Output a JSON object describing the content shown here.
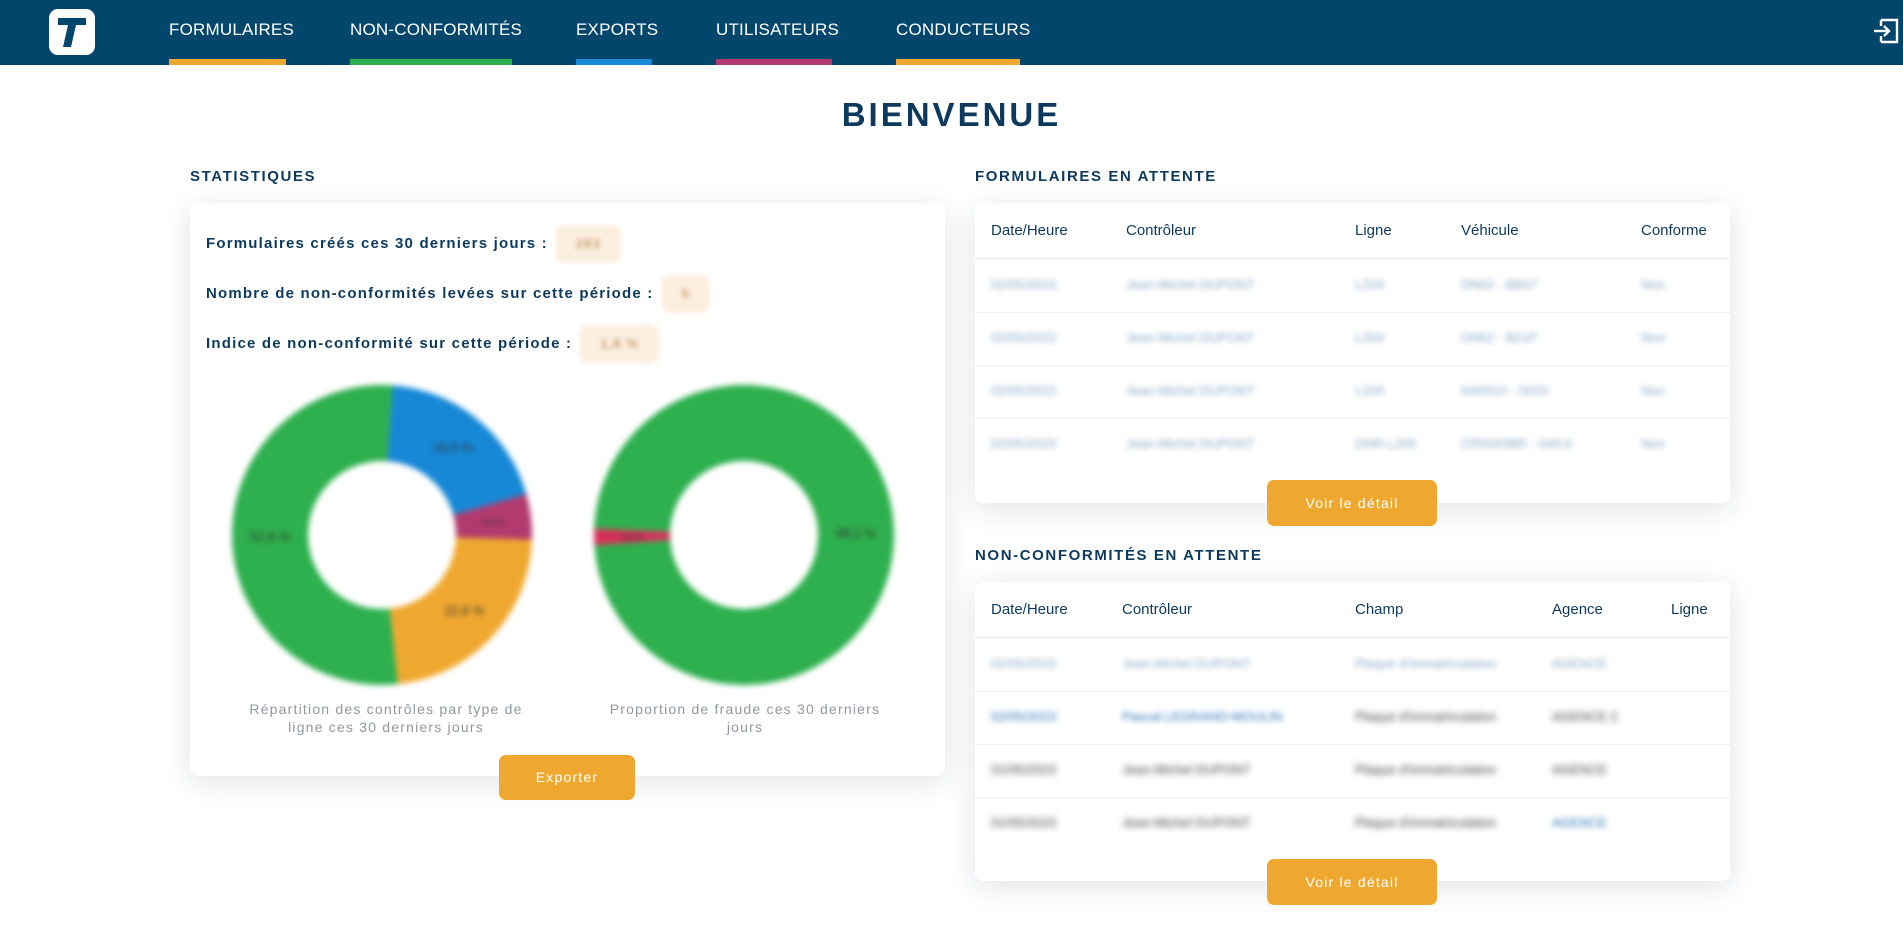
{
  "nav": {
    "items": [
      {
        "label": "FORMULAIRES",
        "color": "#efa82f"
      },
      {
        "label": "NON-CONFORMITÉS",
        "color": "#2eb04e"
      },
      {
        "label": "EXPORTS",
        "color": "#1688d6"
      },
      {
        "label": "UTILISATEURS",
        "color": "#b23a6e"
      },
      {
        "label": "CONDUCTEURS",
        "color": "#efa82f"
      }
    ],
    "logo_icon": "t-logo-icon",
    "logout_icon": "logout-icon"
  },
  "page_title": "BIENVENUE",
  "stats": {
    "section_title": "STATISTIQUES",
    "forms_label": "Formulaires créés ces 30 derniers jours :",
    "forms_value": "283",
    "nc_label": "Nombre de non-conformités levées sur cette période :",
    "nc_value": "5",
    "index_label": "Indice de non-conformité sur cette période :",
    "index_value": "1,8 %",
    "export_label": "Exporter"
  },
  "chart_data": [
    {
      "type": "pie",
      "title": "Répartition des contrôles par type de ligne ces 30 derniers jours",
      "slices": [
        {
          "label": "19,5 %",
          "value": 19.5,
          "color": "#1688d6"
        },
        {
          "label": "4,9 %",
          "value": 4.9,
          "color": "#b23a6e"
        },
        {
          "label": "22,8 %",
          "value": 22.8,
          "color": "#efa82f"
        },
        {
          "label": "52,8 %",
          "value": 52.8,
          "color": "#2eb04e"
        }
      ]
    },
    {
      "type": "pie",
      "title": "Proportion de fraude ces 30 derniers jours",
      "slices": [
        {
          "label": "1,8 %",
          "value": 1.8,
          "color": "#d4325a"
        },
        {
          "label": "98,2 %",
          "value": 98.2,
          "color": "#2eb04e"
        }
      ]
    }
  ],
  "pending_forms": {
    "section_title": "FORMULAIRES EN ATTENTE",
    "columns": [
      "Date/Heure",
      "Contrôleur",
      "Ligne",
      "Véhicule",
      "Conforme"
    ],
    "rows": [
      [
        "02/05/2023",
        "Jean-Michel DUPONT",
        "L204",
        "DN62 - BB47",
        "Non"
      ],
      [
        "02/05/2023",
        "Jean-Michel DUPONT",
        "L204",
        "DN62 - B21P",
        "Non"
      ],
      [
        "02/05/2023",
        "Jean-Michel DUPONT",
        "L204",
        "N40510 - S023",
        "Non"
      ],
      [
        "02/05/2023",
        "Jean-Michel DUPONT",
        "DNR-L205",
        "CR5043BR - S40.6",
        "Non"
      ]
    ],
    "detail_label": "Voir le détail"
  },
  "pending_nc": {
    "section_title": "NON-CONFORMITÉS EN ATTENTE",
    "columns": [
      "Date/Heure",
      "Contrôleur",
      "Champ",
      "Agence",
      "Ligne"
    ],
    "rows": [
      [
        "02/05/2023",
        "Jean-Michel DUPONT",
        "Plaque d'immatriculation",
        "AGENCE",
        ""
      ],
      [
        "02/05/2023",
        "Pascal LEGRAND-MOULIN",
        "Plaque d'immatriculation",
        "AGENCE 2",
        ""
      ],
      [
        "01/05/2023",
        "Jean-Michel DUPONT",
        "Plaque d'immatriculation",
        "AGENCE",
        ""
      ],
      [
        "01/05/2023",
        "Jean-Michel DUPONT",
        "Plaque d'immatriculation",
        "AGENCE",
        ""
      ]
    ],
    "detail_label": "Voir le détail"
  }
}
